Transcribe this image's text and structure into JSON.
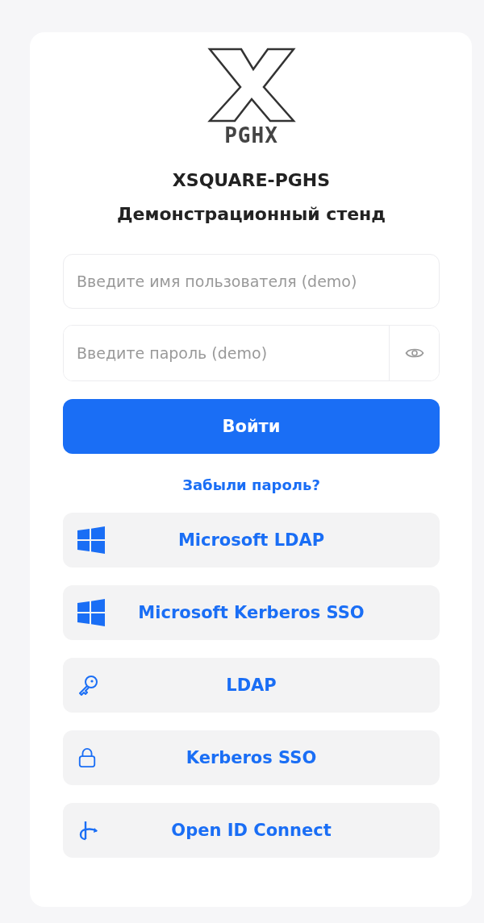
{
  "logo": {
    "text": "PGHX"
  },
  "title": "XSQUARE-PGHS",
  "subtitle": "Демонстрационный стенд",
  "username": {
    "placeholder": "Введите имя пользователя (demo)"
  },
  "password": {
    "placeholder": "Введите пароль (demo)"
  },
  "login_button": "Войти",
  "forgot_link": "Забыли пароль?",
  "sso_buttons": [
    {
      "label": "Microsoft LDAP",
      "kind": "windows"
    },
    {
      "label": "Microsoft Kerberos SSO",
      "kind": "windows"
    },
    {
      "label": "LDAP",
      "kind": "key"
    },
    {
      "label": "Kerberos SSO",
      "kind": "lock"
    },
    {
      "label": "Open ID Connect",
      "kind": "openid"
    }
  ]
}
